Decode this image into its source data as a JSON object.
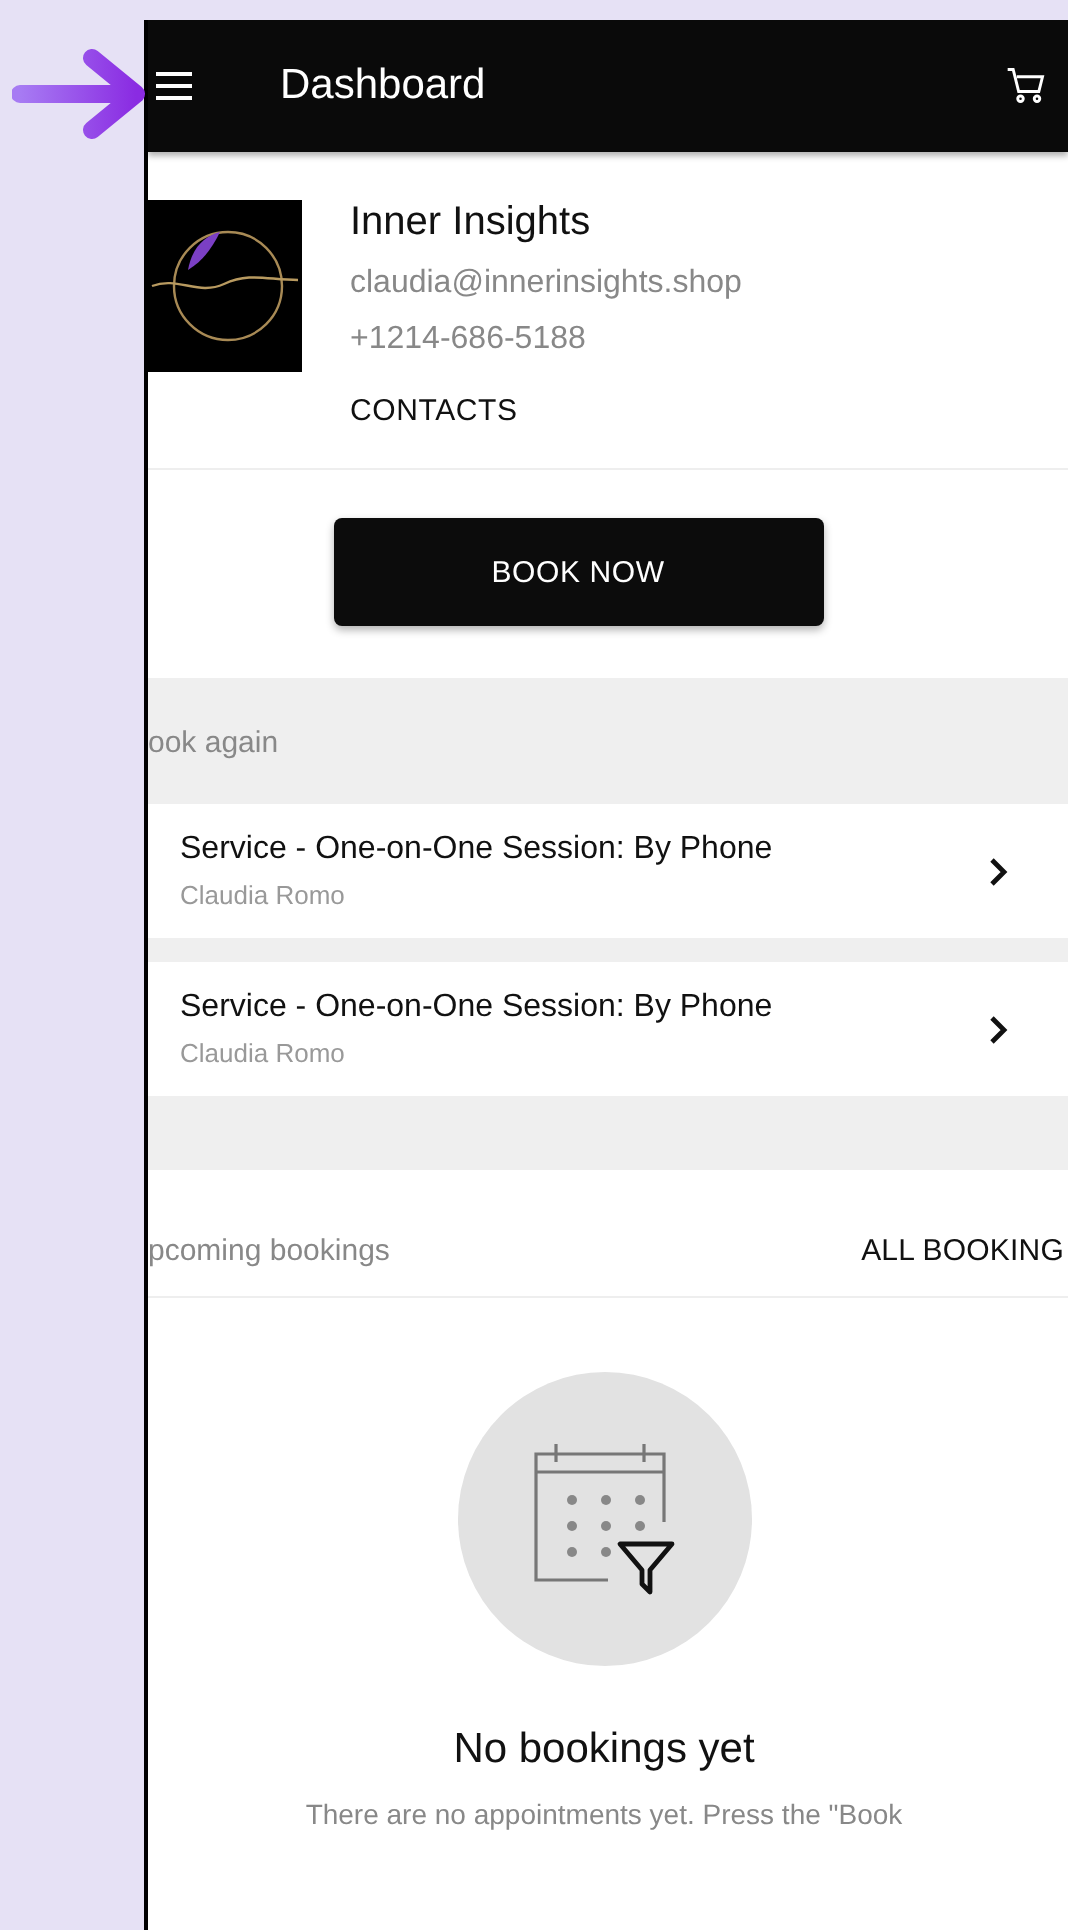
{
  "header": {
    "title": "Dashboard"
  },
  "business": {
    "name": "Inner Insights",
    "email": "claudia@innerinsights.shop",
    "phone": "+1214-686-5188",
    "contacts_link": "CONTACTS"
  },
  "book_button": "BOOK NOW",
  "book_again": {
    "heading": "ook again",
    "items": [
      {
        "title": "Service - One-on-One Session: By Phone",
        "subtitle": "Claudia Romo"
      },
      {
        "title": "Service - One-on-One Session: By Phone",
        "subtitle": "Claudia Romo"
      }
    ]
  },
  "upcoming": {
    "heading": "pcoming bookings",
    "all_link": "ALL BOOKING"
  },
  "empty_state": {
    "title": "No bookings yet",
    "message": "There are no appointments yet. Press the \"Book"
  }
}
